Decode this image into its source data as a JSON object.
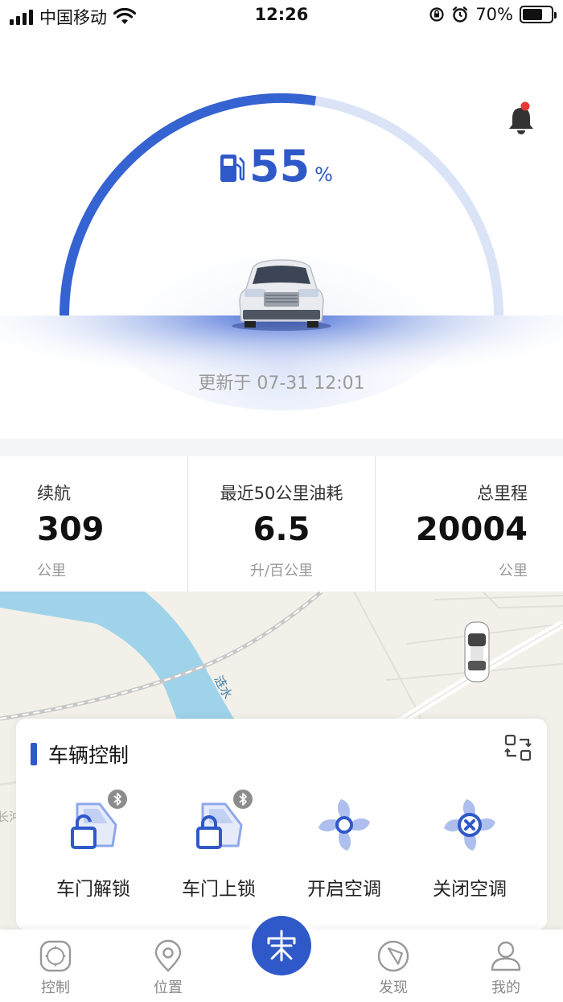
{
  "status_bar": {
    "carrier": "中国移动",
    "time": "12:26",
    "battery_percent": "70%",
    "battery_level": 0.7
  },
  "hero": {
    "fuel_value": "55",
    "fuel_unit": "%",
    "fuel_level": 0.55,
    "updated_prefix": "更新于",
    "updated_time": "07-31 12:01",
    "accent_color": "#2f59c8"
  },
  "stats": [
    {
      "label": "续航",
      "value": "309",
      "unit": "公里"
    },
    {
      "label": "最近50公里油耗",
      "value": "6.5",
      "unit": "升/百公里"
    },
    {
      "label": "总里程",
      "value": "20004",
      "unit": "公里"
    }
  ],
  "map": {
    "river_label": "涟水",
    "edge_label": "长沖"
  },
  "control_card": {
    "title": "车辆控制",
    "items": [
      {
        "label": "车门解锁",
        "icon": "door-unlock-icon",
        "bluetooth": true
      },
      {
        "label": "车门上锁",
        "icon": "door-lock-icon",
        "bluetooth": true
      },
      {
        "label": "开启空调",
        "icon": "fan-on-icon",
        "bluetooth": false
      },
      {
        "label": "关闭空调",
        "icon": "fan-off-icon",
        "bluetooth": false
      }
    ]
  },
  "tabbar": {
    "tabs": [
      {
        "label": "控制",
        "icon": "control-icon"
      },
      {
        "label": "位置",
        "icon": "location-pin-icon"
      },
      {
        "label": "发现",
        "icon": "compass-icon"
      },
      {
        "label": "我的",
        "icon": "user-icon"
      }
    ],
    "center_glyph": "宋"
  }
}
